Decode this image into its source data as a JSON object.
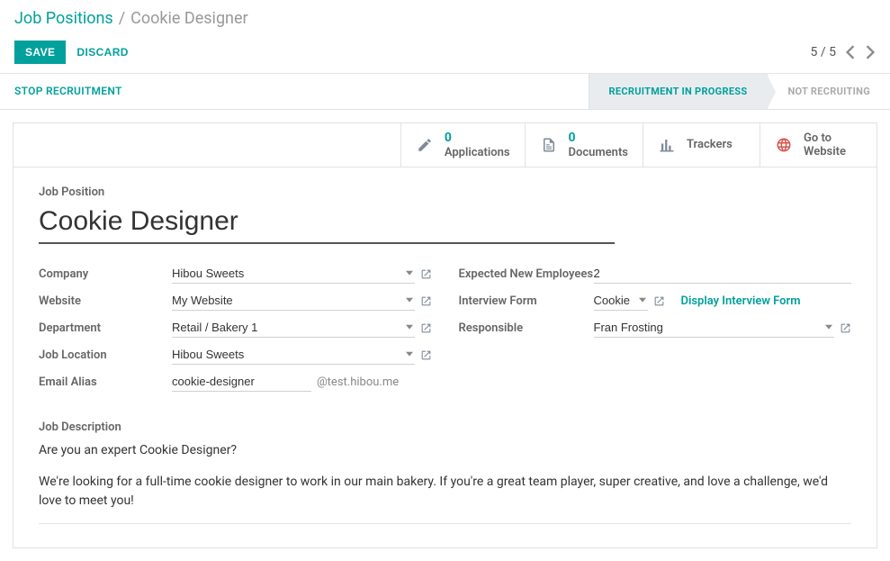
{
  "breadcrumb": {
    "parent": "Job Positions",
    "sep": "/",
    "current": "Cookie Designer"
  },
  "actions": {
    "save": "SAVE",
    "discard": "DISCARD"
  },
  "pager": {
    "text": "5 / 5"
  },
  "status": {
    "stop": "STOP RECRUITMENT",
    "stage_active": "RECRUITMENT IN PROGRESS",
    "stage_inactive": "NOT RECRUITING"
  },
  "stats": {
    "applications_count": "0",
    "applications_label": "Applications",
    "documents_count": "0",
    "documents_label": "Documents",
    "trackers_label": "Trackers",
    "website_line1": "Go to",
    "website_line2": "Website"
  },
  "form": {
    "job_position_label": "Job Position",
    "job_position_value": "Cookie Designer",
    "left": {
      "company_label": "Company",
      "company_value": "Hibou Sweets",
      "website_label": "Website",
      "website_value": "My Website",
      "department_label": "Department",
      "department_value": "Retail / Bakery 1",
      "location_label": "Job Location",
      "location_value": "Hibou Sweets",
      "email_label": "Email Alias",
      "email_value": "cookie-designer",
      "email_domain": "@test.hibou.me"
    },
    "right": {
      "expected_label": "Expected New Employees",
      "expected_value": "2",
      "interview_label": "Interview Form",
      "interview_value": "Cookie",
      "display_link": "Display Interview Form",
      "responsible_label": "Responsible",
      "responsible_value": "Fran Frosting"
    },
    "desc_label": "Job Description",
    "desc_p1": "Are you an expert Cookie Designer?",
    "desc_p2": "We're looking for a full-time cookie designer to work in our main bakery. If you're a great team player, super creative, and love a challenge, we'd love to meet you!"
  }
}
